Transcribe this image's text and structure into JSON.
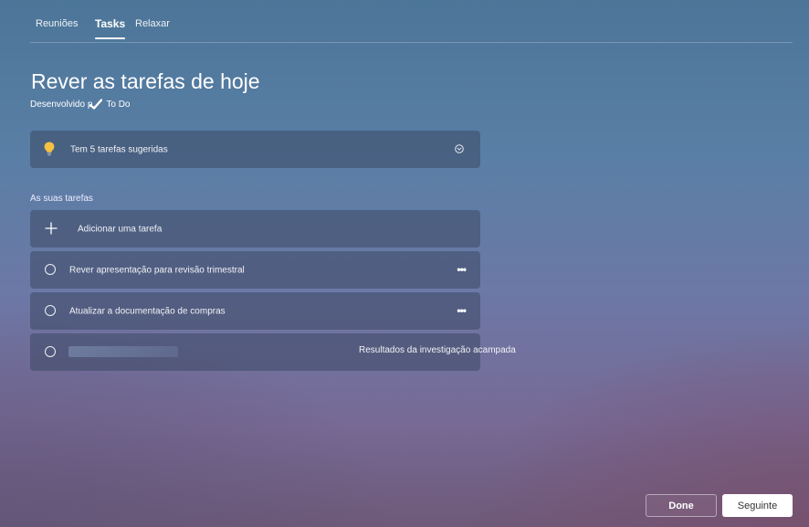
{
  "tabs": [
    {
      "label": "Reuniões"
    },
    {
      "label": "Tasks"
    },
    {
      "label": "Relaxar"
    }
  ],
  "header": {
    "title": "Rever as tarefas de hoje",
    "developed_by": "Desenvolvido p",
    "app_name": "To Do"
  },
  "suggestions": {
    "text": "Tem 5 tarefas sugeridas",
    "icon": "lightbulb-icon",
    "expand_icon": "chevron-down-icon"
  },
  "tasks_section": {
    "label": "As suas tarefas",
    "add_label": "Adicionar uma tarefa",
    "items": [
      {
        "text": "Rever apresentação para revisão trimestral"
      },
      {
        "text": "Atualizar a documentação de compras"
      },
      {
        "text": "Resultados da investigação acampada"
      }
    ]
  },
  "footer": {
    "done_label": "Done",
    "next_label": "Seguinte"
  },
  "colors": {
    "bulb": "#f5c242",
    "card": "#3c4864"
  }
}
